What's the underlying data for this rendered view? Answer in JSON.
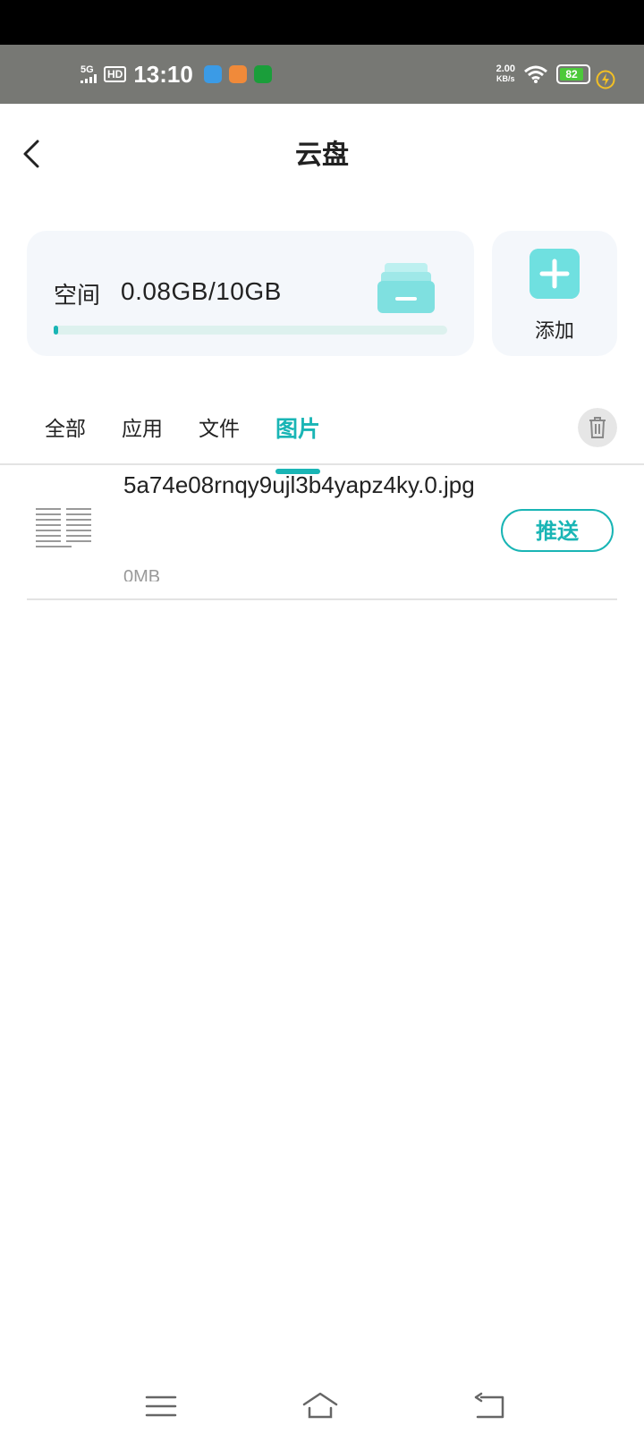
{
  "status_bar": {
    "network": "5G",
    "hd": "HD",
    "time": "13:10",
    "net_speed_value": "2.00",
    "net_speed_unit": "KB/s",
    "battery_level": "82",
    "colors": {
      "battery": "#4cc93a",
      "charging": "#f3c024"
    }
  },
  "header": {
    "title": "云盘"
  },
  "storage": {
    "label": "空间",
    "usage": "0.08GB/10GB",
    "used_fraction": 0.008
  },
  "add": {
    "label": "添加"
  },
  "tabs": [
    {
      "label": "全部",
      "active": false
    },
    {
      "label": "应用",
      "active": false
    },
    {
      "label": "文件",
      "active": false
    },
    {
      "label": "图片",
      "active": true
    }
  ],
  "files": [
    {
      "name": "5a74e08rnqy9ujl3b4yapz4ky.0.jpg",
      "size": "0MB",
      "action": "推送"
    }
  ],
  "colors": {
    "accent": "#19b5b5",
    "add_button": "#6fe0e0",
    "card_bg": "#f4f7fb"
  },
  "icons": {
    "back": "chevron-left-icon",
    "tray": "inbox-tray-icon",
    "add": "plus-icon",
    "delete": "trash-icon",
    "nav_menu": "menu-icon",
    "nav_home": "home-icon",
    "nav_back": "return-icon"
  }
}
